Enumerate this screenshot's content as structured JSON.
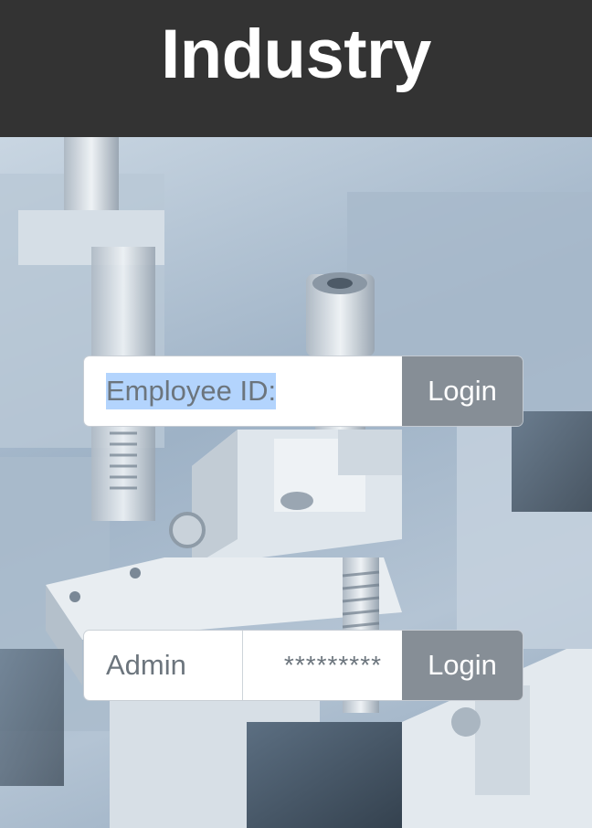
{
  "header": {
    "title": "Industry"
  },
  "employee_login": {
    "field_text": "Employee ID:",
    "button_label": "Login"
  },
  "admin_login": {
    "username_value": "Admin",
    "password_value": "*********",
    "button_label": "Login"
  },
  "background": {
    "description_icon": "machinery-photo"
  },
  "colors": {
    "header_bg": "#333333",
    "button_bg": "#868e96",
    "selection": "#b3d4fd"
  }
}
